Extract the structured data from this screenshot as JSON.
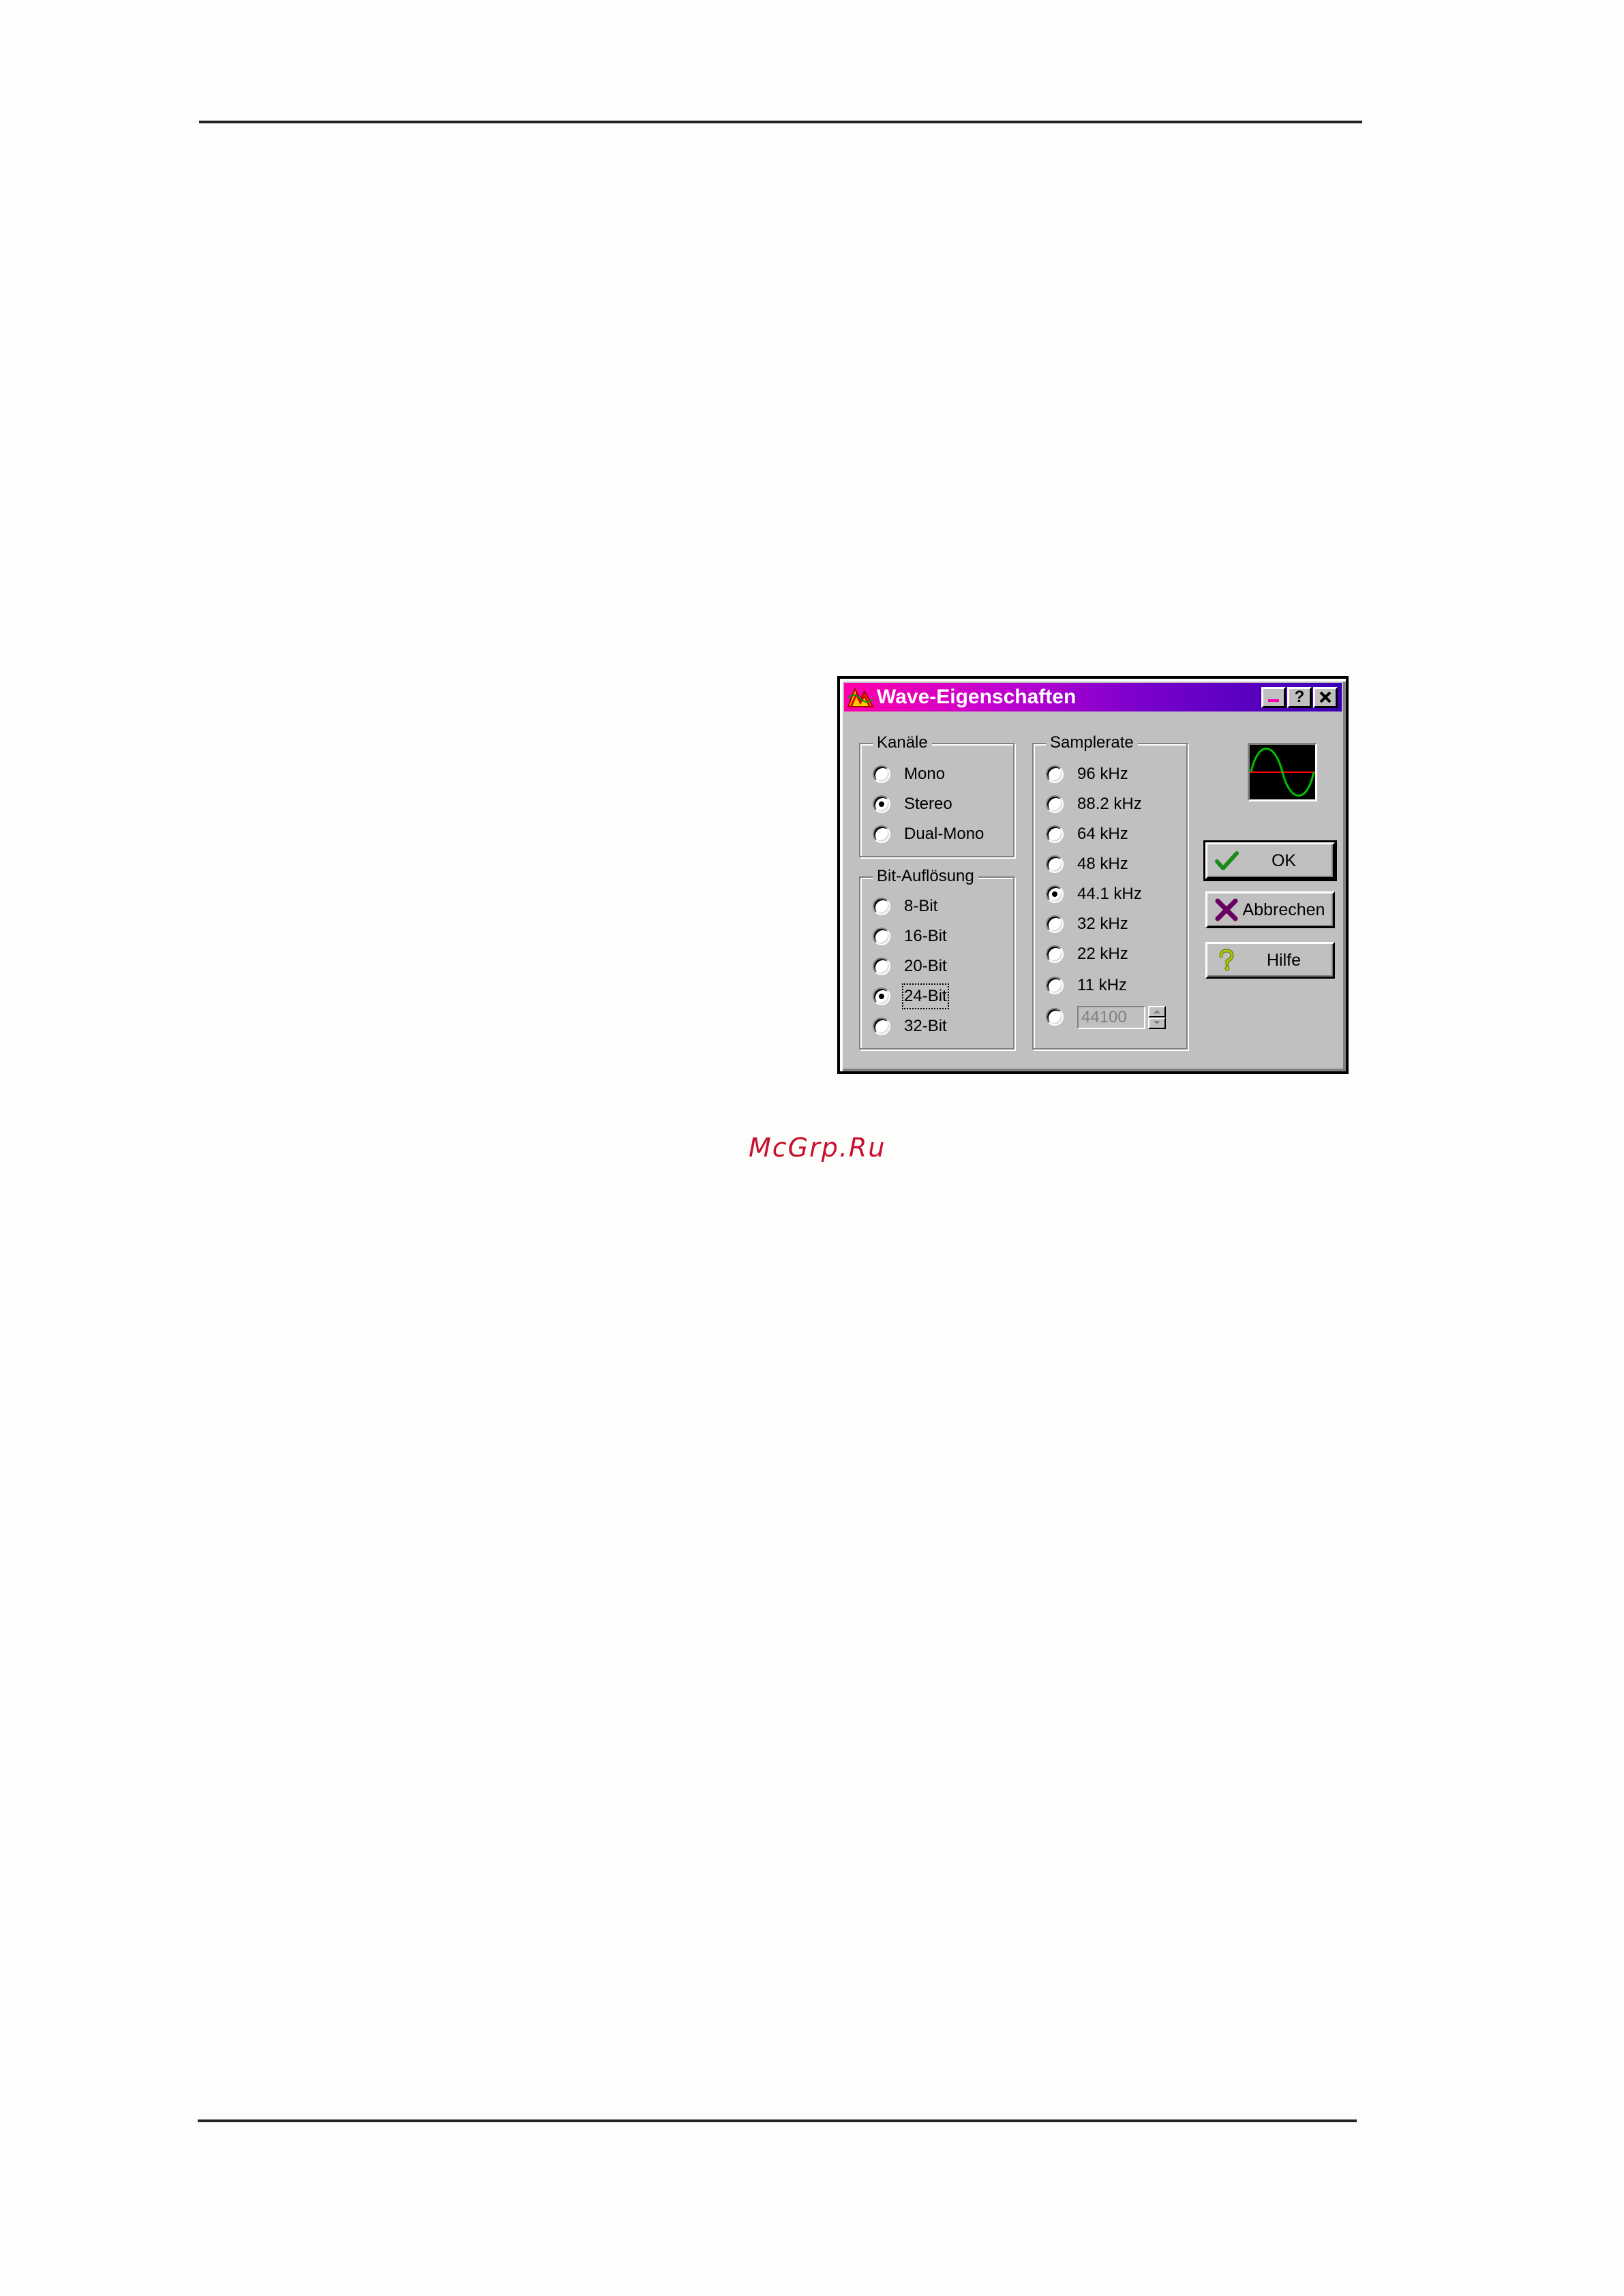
{
  "watermark": "McGrp.Ru",
  "dialog": {
    "title": "Wave-Eigenschaften",
    "caption_buttons": {
      "minimize": "–",
      "help": "?",
      "close": "✕"
    },
    "channels": {
      "title": "Kanäle",
      "options": [
        {
          "label": "Mono",
          "checked": false
        },
        {
          "label": "Stereo",
          "checked": true
        },
        {
          "label": "Dual-Mono",
          "checked": false
        }
      ]
    },
    "bit_resolution": {
      "title": "Bit-Auflösung",
      "options": [
        {
          "label": "8-Bit",
          "checked": false
        },
        {
          "label": "16-Bit",
          "checked": false
        },
        {
          "label": "20-Bit",
          "checked": false
        },
        {
          "label": "24-Bit",
          "checked": true
        },
        {
          "label": "32-Bit",
          "checked": false
        }
      ]
    },
    "sample_rate": {
      "title": "Samplerate",
      "options": [
        {
          "label": "96 kHz",
          "checked": false
        },
        {
          "label": "88.2 kHz",
          "checked": false
        },
        {
          "label": "64 kHz",
          "checked": false
        },
        {
          "label": "48 kHz",
          "checked": false
        },
        {
          "label": "44.1 kHz",
          "checked": true
        },
        {
          "label": "32 kHz",
          "checked": false
        },
        {
          "label": "22 kHz",
          "checked": false
        },
        {
          "label": "11 kHz",
          "checked": false
        }
      ],
      "custom_value": "44100",
      "custom_checked": false
    },
    "buttons": {
      "ok": "OK",
      "cancel": "Abbrechen",
      "help": "Hilfe"
    },
    "icons": {
      "app": "app-wave-icon",
      "scope": "sine-wave-preview",
      "ok": "checkmark-icon",
      "cancel": "x-cross-icon",
      "help": "question-mark-icon"
    },
    "colors": {
      "title_gradient_start": "#ff00a8",
      "title_gradient_end": "#3a00b6",
      "face": "#c0c0c0",
      "scope_wave": "#00c000",
      "scope_axis": "#ff0000",
      "ok_check": "#1a8a1a",
      "cancel_x": "#6a0060",
      "help_q": "#b0d000"
    }
  }
}
